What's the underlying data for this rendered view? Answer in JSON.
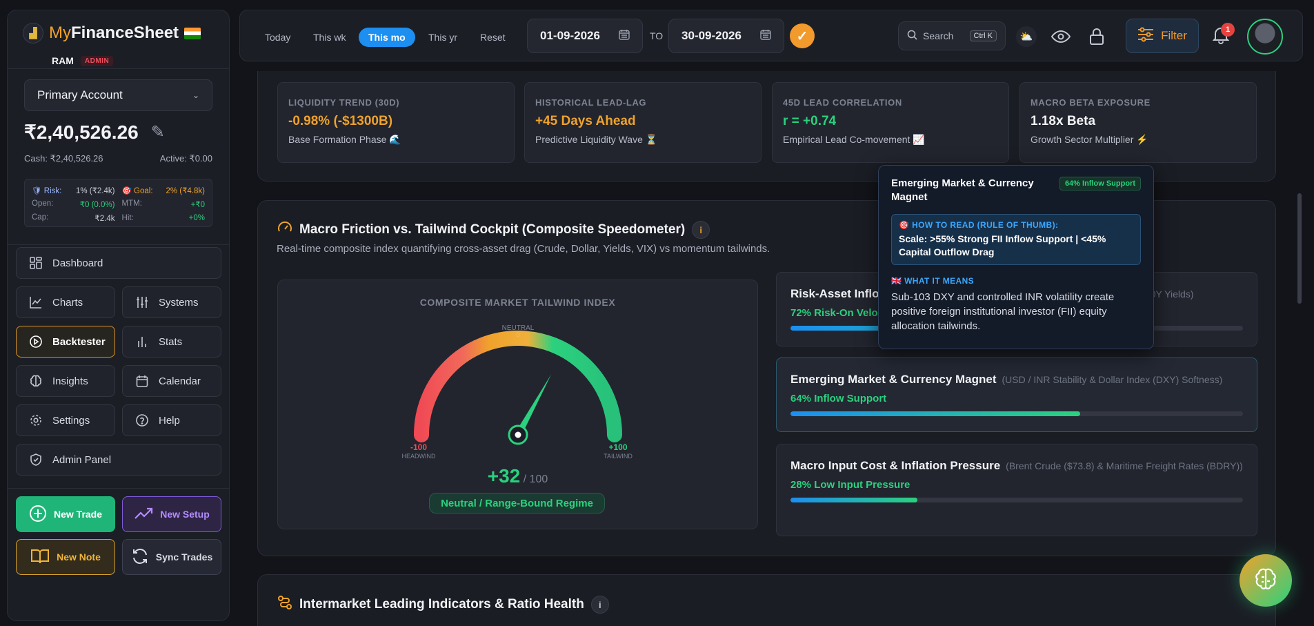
{
  "brand": {
    "my": "My",
    "fs": "FinanceSheet",
    "user": "RAM",
    "role": "ADMIN"
  },
  "account": {
    "selected": "Primary Account",
    "balance": "₹2,40,526.26",
    "cash": "Cash: ₹2,40,526.26",
    "active": "Active: ₹0.00"
  },
  "risk": {
    "risk_label": "Risk:",
    "risk_value": "1% (₹2.4k)",
    "goal_label": "Goal:",
    "goal_value": "2% (₹4.8k)",
    "open_label": "Open:",
    "open_value": "₹0 (0.0%)",
    "mtm_label": "MTM:",
    "mtm_value": "+₹0",
    "cap_label": "Cap:",
    "cap_value": "₹2.4k",
    "hit_label": "Hit:",
    "hit_value": "+0%"
  },
  "nav": {
    "dashboard": "Dashboard",
    "charts": "Charts",
    "systems": "Systems",
    "backtester": "Backtester",
    "stats": "Stats",
    "insights": "Insights",
    "calendar": "Calendar",
    "settings": "Settings",
    "help": "Help",
    "admin": "Admin Panel"
  },
  "actions": {
    "new_trade": "New Trade",
    "new_setup": "New Setup",
    "new_note": "New Note",
    "sync": "Sync Trades"
  },
  "header": {
    "ranges": [
      "Today",
      "This wk",
      "This mo",
      "This yr",
      "Reset"
    ],
    "active_range": "This mo",
    "date_from": "01-09-2026",
    "to": "TO",
    "date_to": "30-09-2026",
    "search": "Search",
    "shortcut": "Ctrl K",
    "filter": "Filter",
    "notifications": "1"
  },
  "stats": [
    {
      "label": "LIQUIDITY TREND (30D)",
      "value": "-0.98% (-$1300B)",
      "sub": "Base Formation Phase 🌊",
      "color": "#f0a22b"
    },
    {
      "label": "HISTORICAL LEAD-LAG",
      "value": "+45 Days Ahead",
      "sub": "Predictive Liquidity Wave ⏳",
      "color": "#f0a22b"
    },
    {
      "label": "45D LEAD CORRELATION",
      "value": "r = +0.74",
      "sub": "Empirical Lead Co-movement 📈",
      "color": "#2bd17e"
    },
    {
      "label": "MACRO BETA EXPOSURE",
      "value": "1.18x Beta",
      "sub": "Growth Sector Multiplier ⚡",
      "color": "#f2f3f6"
    }
  ],
  "cockpit": {
    "title": "Macro Friction vs. Tailwind Cockpit (Composite Speedometer)",
    "subtitle": "Real-time composite index quantifying cross-asset drag (Crude, Dollar, Yields, VIX) vs momentum tailwinds.",
    "gauge_title": "COMPOSITE MARKET TAILWIND INDEX",
    "neutral": "NEUTRAL",
    "neutral_zero": "0",
    "min": "-100",
    "min_label": "HEADWIND",
    "max": "+100",
    "max_label": "TAILWIND",
    "score": "+32",
    "score_max": "/ 100",
    "score_value": 32,
    "regime": "Neutral / Range-Bound Regime"
  },
  "metrics": [
    {
      "title": "Risk-Asset Inflow",
      "desc": "0Y Yields)",
      "value": "72% Risk-On Veloc",
      "fill": 0.72
    },
    {
      "title": "Emerging Market & Currency Magnet",
      "desc": "(USD / INR Stability & Dollar Index (DXY) Softness)",
      "value": "64% Inflow Support",
      "fill": 0.64
    },
    {
      "title": "Macro Input Cost & Inflation Pressure",
      "desc": "(Brent Crude ($73.8) & Maritime Freight Rates (BDRY))",
      "value": "28% Low Input Pressure",
      "fill": 0.28
    }
  ],
  "tooltip": {
    "title": "Emerging Market & Currency Magnet",
    "badge": "64% Inflow Support",
    "rule_head": "🎯 HOW TO READ (RULE OF THUMB):",
    "rule": "Scale: >55% Strong FII Inflow Support | <45% Capital Outflow Drag",
    "means_head": "🇬🇧 WHAT IT MEANS",
    "means": "Sub-103 DXY and controlled INR volatility create positive foreign institutional investor (FII) equity allocation tailwinds."
  },
  "section2": {
    "title": "Intermarket Leading Indicators & Ratio Health"
  }
}
